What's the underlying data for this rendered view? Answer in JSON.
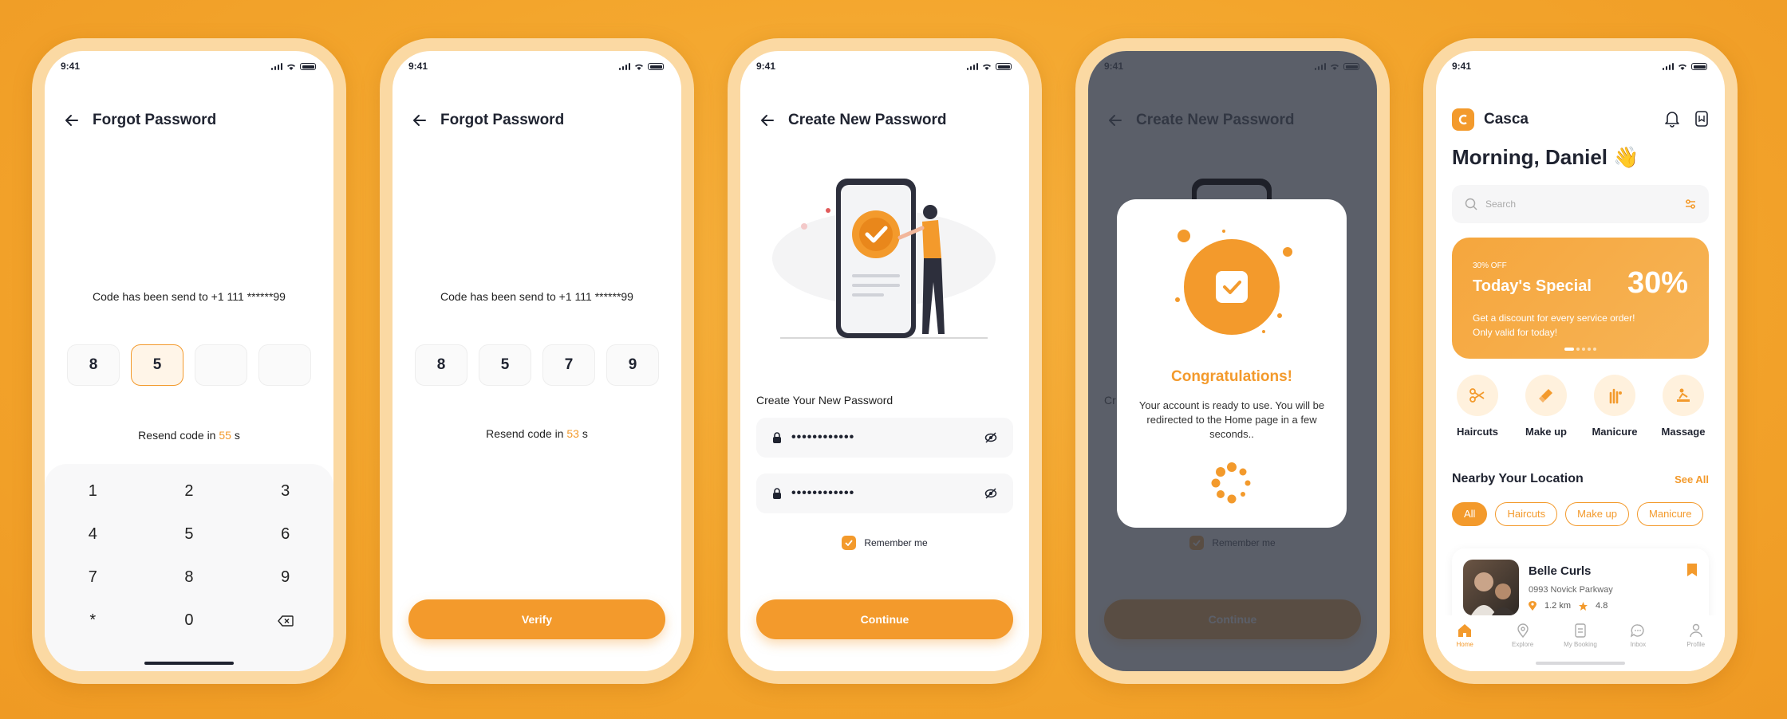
{
  "status_time": "9:41",
  "forgot": {
    "title": "Forgot Password",
    "message": "Code has been send to +1 111 ******99",
    "resend_prefix": "Resend code in ",
    "resend_suffix": " s"
  },
  "screen1": {
    "otp": [
      "8",
      "5",
      "",
      ""
    ],
    "seconds": "55"
  },
  "screen2": {
    "otp": [
      "8",
      "5",
      "7",
      "9"
    ],
    "seconds": "53",
    "verify_label": "Verify"
  },
  "keypad": [
    "1",
    "2",
    "3",
    "4",
    "5",
    "6",
    "7",
    "8",
    "9",
    "*",
    "0"
  ],
  "create": {
    "title": "Create New Password",
    "label": "Create Your New Password",
    "password_mask": "••••••••••••",
    "remember": "Remember me",
    "continue_label": "Continue",
    "label_clip": "Cr"
  },
  "congrats": {
    "title": "Congratulations!",
    "message": "Your account is ready to use. You will be redirected to the Home page in a few seconds.."
  },
  "home": {
    "brand": "Casca",
    "greeting": "Morning, Daniel 👋",
    "search_placeholder": "Search",
    "promo": {
      "off": "30% OFF",
      "name": "Today's Special",
      "percent": "30%",
      "desc_line1": "Get a discount for every service order!",
      "desc_line2": "Only valid for today!"
    },
    "categories": [
      "Haircuts",
      "Make up",
      "Manicure",
      "Massage"
    ],
    "section_title": "Nearby Your Location",
    "see_all": "See All",
    "chips": [
      "All",
      "Haircuts",
      "Make up",
      "Manicure"
    ],
    "salon": {
      "name": "Belle Curls",
      "address": "0993 Novick Parkway",
      "distance": "1.2 km",
      "rating": "4.8"
    },
    "tabs": [
      "Home",
      "Explore",
      "My Booking",
      "Inbox",
      "Profile"
    ]
  },
  "colors": {
    "accent": "#f39a2c",
    "background": "#f3a52c",
    "overlay": "#373c48"
  }
}
